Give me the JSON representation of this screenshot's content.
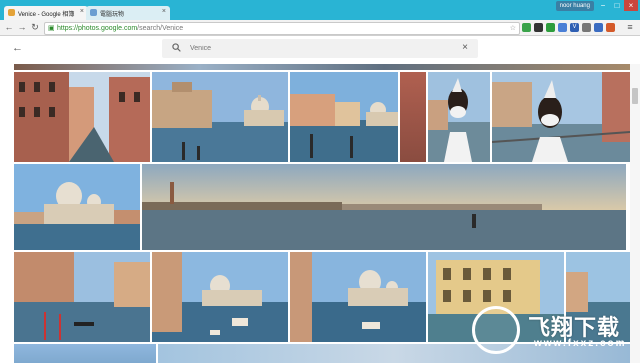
{
  "browser": {
    "tabs": [
      {
        "label": "Venice - Google 相簿",
        "active": true
      },
      {
        "label": "電腦玩物",
        "active": false
      }
    ],
    "user": "noor huang",
    "url_host": "https://photos.google.com",
    "url_path": "/search/Venice",
    "window_controls": [
      "−",
      "□",
      "×"
    ]
  },
  "photos_header": {
    "search_placeholder": "Venice",
    "search_value": ""
  },
  "watermark": {
    "title": "飞翔下载",
    "subtitle": "www.fxxz.com"
  },
  "colors": {
    "frame": "#29b4d4",
    "toolbar": "#f2f2f2",
    "url_green": "#2a8a2a"
  }
}
